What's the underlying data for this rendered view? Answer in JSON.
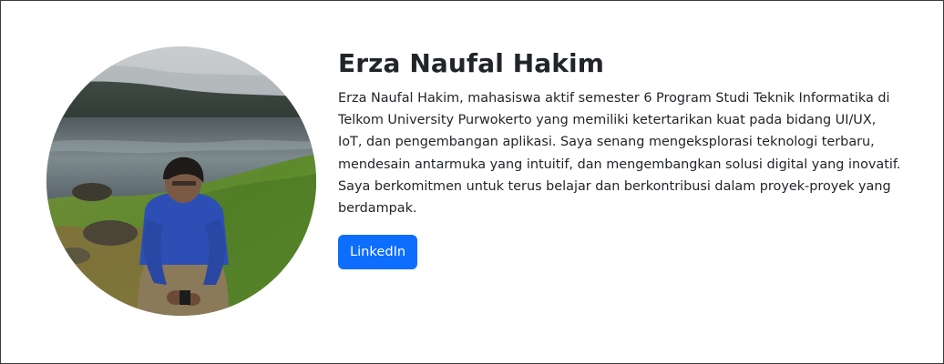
{
  "profile": {
    "name": "Erza Naufal Hakim",
    "bio": "Erza Naufal Hakim, mahasiswa aktif semester 6 Program Studi Teknik Informatika di Telkom University Purwokerto yang memiliki ketertarikan kuat pada bidang UI/UX, IoT, dan pengembangan aplikasi. Saya senang mengeksplorasi teknologi terbaru, mendesain antarmuka yang intuitif, dan mengembangkan solusi digital yang inovatif. Saya berkomitmen untuk terus belajar dan berkontribusi dalam proyek-proyek yang berdampak.",
    "linkedin_label": "LinkedIn",
    "photo_alt": "profile photo"
  },
  "colors": {
    "button_bg": "#0d6efd",
    "button_text": "#ffffff",
    "text": "#212529"
  }
}
